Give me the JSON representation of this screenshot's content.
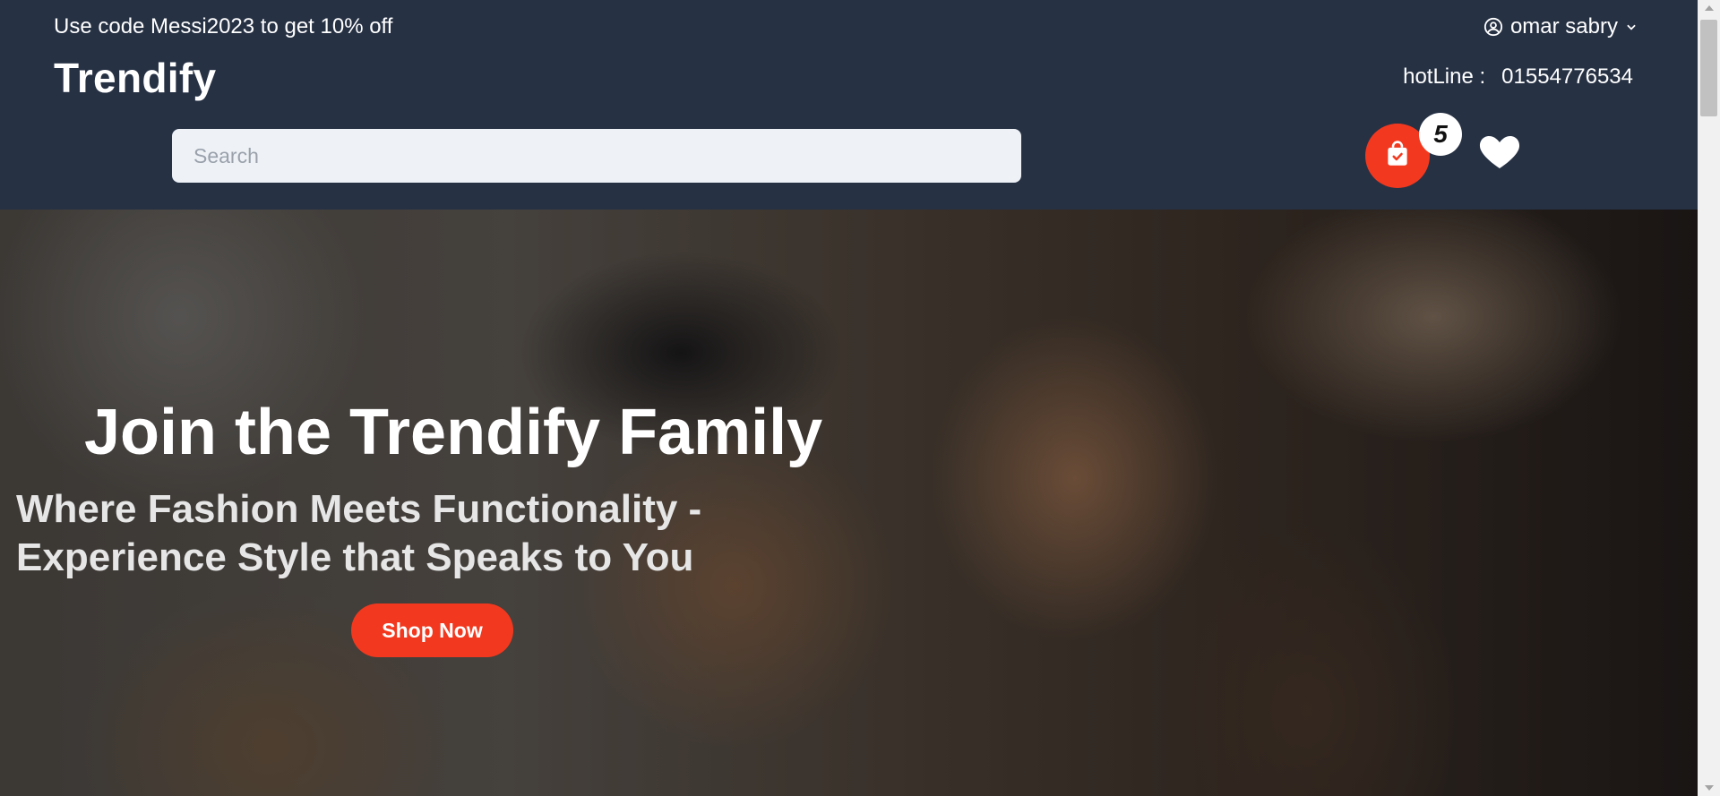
{
  "header": {
    "promo_text": "Use code Messi2023 to get 10% off",
    "user_name": "omar sabry",
    "logo_text": "Trendify",
    "hotline_label": "hotLine :",
    "hotline_number": "01554776534",
    "search_placeholder": "Search",
    "search_value": "",
    "cart_count": "5"
  },
  "hero": {
    "title": "Join the Trendify Family",
    "subtitle": "Where Fashion Meets Functionality - Experience Style that Speaks to You",
    "cta_label": "Shop Now"
  },
  "icons": {
    "user": "user-circle-icon",
    "dropdown": "chevron-down-icon",
    "cart": "shopping-bag-check-icon",
    "wishlist": "heart-icon"
  },
  "colors": {
    "header_bg": "#263144",
    "accent": "#f2391f",
    "search_bg": "#eef2f7",
    "text_light": "#ffffff"
  }
}
